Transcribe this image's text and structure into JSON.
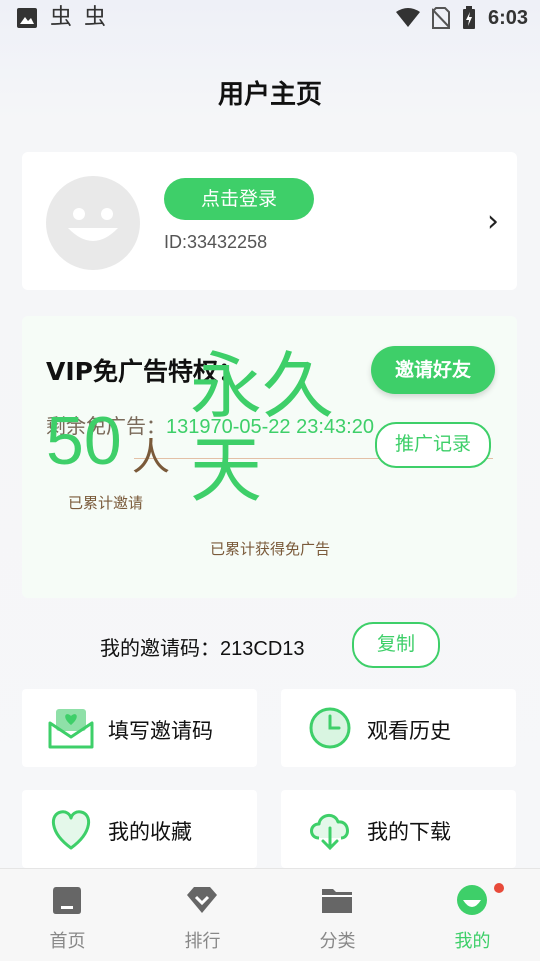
{
  "status_bar": {
    "time": "6:03"
  },
  "page_title": "用户主页",
  "profile": {
    "login_label": "点击登录",
    "user_id": "ID:33432258"
  },
  "vip": {
    "title": "VIP免广告特权：",
    "invite_button": "邀请好友",
    "remaining_label": "剩余免广告：",
    "remaining_value": "131970-05-22 23:43:20",
    "promo_button": "推广记录",
    "invite_count": "50",
    "invite_unit": "人",
    "forever_label": "永久天",
    "cumulative_invites_label": "已累计邀请",
    "cumulative_free_label": "已累计获得免广告"
  },
  "invite_code": {
    "label": "我的邀请码：",
    "value": "213CD13",
    "copy_button": "复制"
  },
  "tiles": [
    {
      "label": "填写邀请码",
      "icon": "mail-heart-icon"
    },
    {
      "label": "观看历史",
      "icon": "clock-icon"
    },
    {
      "label": "我的收藏",
      "icon": "heart-icon"
    },
    {
      "label": "我的下载",
      "icon": "cloud-download-icon"
    }
  ],
  "tabs": [
    {
      "label": "首页",
      "icon": "home-icon"
    },
    {
      "label": "排行",
      "icon": "ranking-icon"
    },
    {
      "label": "分类",
      "icon": "folder-icon"
    },
    {
      "label": "我的",
      "icon": "smile-face-icon"
    }
  ],
  "colors": {
    "accent": "#3ecf69",
    "badge": "#e84a3a"
  }
}
